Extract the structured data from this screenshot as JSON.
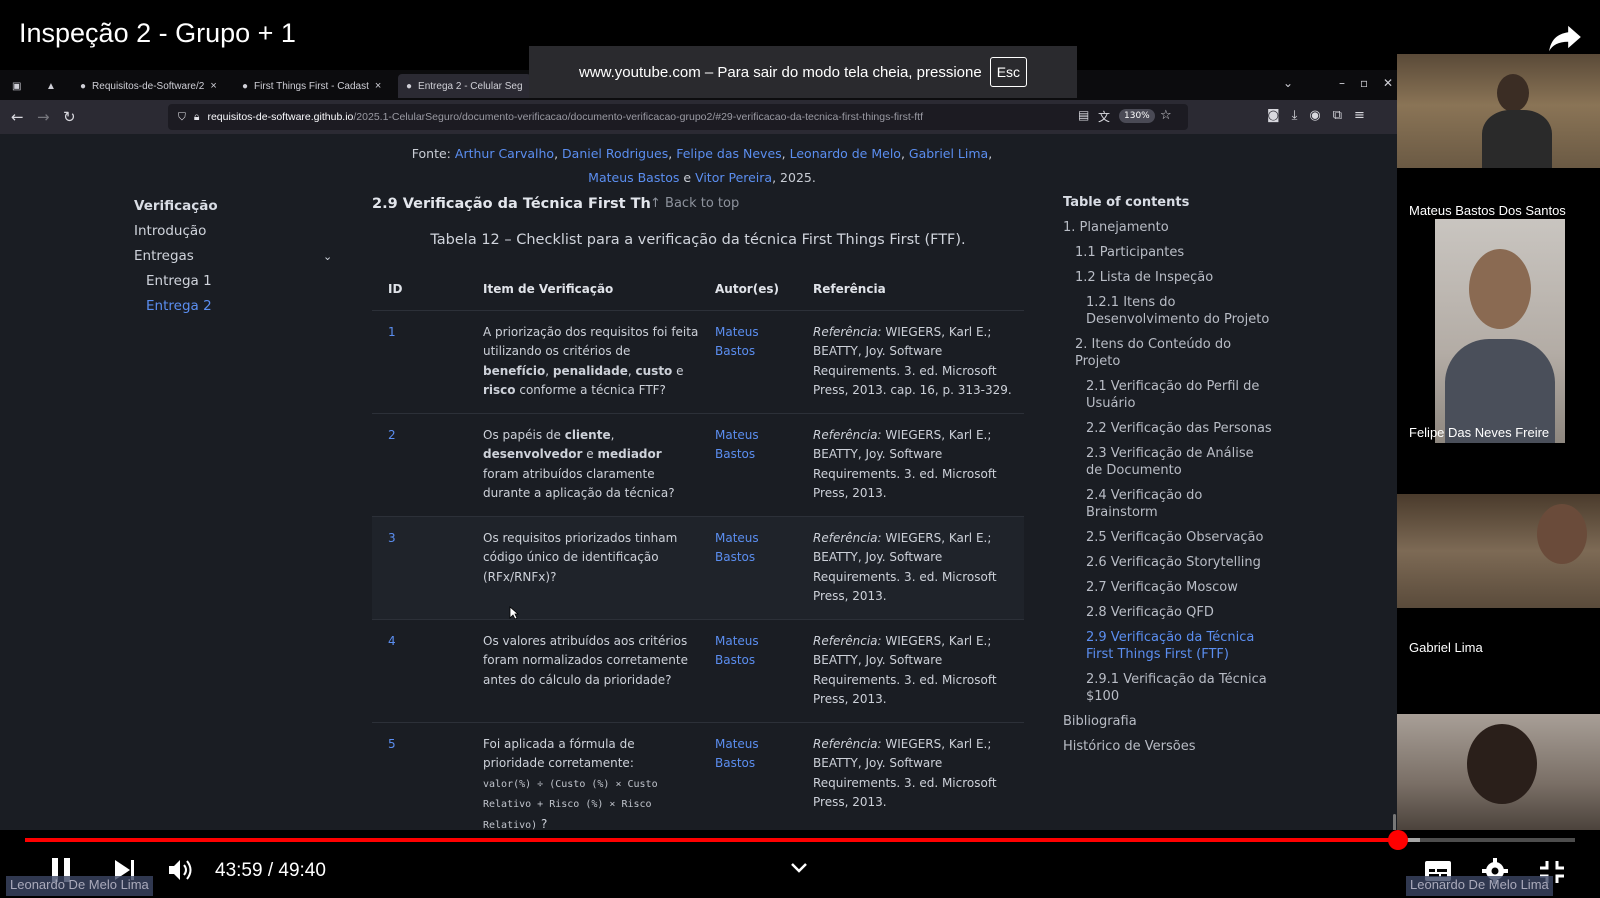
{
  "video": {
    "title": "Inspeção 2 - Grupo + 1",
    "time_current": "43:59",
    "time_separator": "/",
    "time_total": "49:40",
    "progress_fraction": 0.886,
    "buffered_fraction": 0.9
  },
  "fullscreen_notice": {
    "text": "www.youtube.com – Para sair do modo tela cheia, pressione",
    "key": "Esc"
  },
  "browser": {
    "tabs": [
      {
        "label": "Requisitos-de-Software/2",
        "close": "×"
      },
      {
        "label": "First Things First - Cadast",
        "close": "×"
      },
      {
        "label": "Entrega 2 - Celular Seg",
        "close": ""
      }
    ],
    "url_host": "requisitos-de-software.github.io",
    "url_path": "/2025.1-CelularSeguro/documento-verificacao/documento-verificacao-grupo2/#29-verificacao-da-tecnica-first-things-first-ftf",
    "zoom": "130%"
  },
  "page": {
    "fonte_label": "Fonte:",
    "fonte_authors": [
      "Arthur Carvalho",
      "Daniel Rodrigues",
      "Felipe das Neves",
      "Leonardo de Melo",
      "Gabriel Lima",
      "Mateus Bastos",
      "Vitor Pereira"
    ],
    "fonte_year": ", 2025.",
    "fonte_and": " e ",
    "left_nav": {
      "heading": "Verificação",
      "items": [
        "Introdução",
        "Entregas",
        "Entrega 1",
        "Entrega 2"
      ]
    },
    "section_title": "2.9 Verificação da Técnica First Th",
    "back_to_top": "Back to top",
    "caption": "Tabela 12 – Checklist para a verificação da técnica First Things First (FTF).",
    "table": {
      "headers": [
        "ID",
        "Item de Verificação",
        "Autor(es)",
        "Referência"
      ],
      "rows": [
        {
          "id": "1",
          "author": "Mateus Bastos",
          "ref": "WIEGERS, Karl E.; BEATTY, Joy. Software Requirements. 3. ed. Microsoft Press, 2013. cap. 16, p. 313-329."
        },
        {
          "id": "2",
          "author": "Mateus Bastos",
          "ref": "WIEGERS, Karl E.; BEATTY, Joy. Software Requirements. 3. ed. Microsoft Press, 2013."
        },
        {
          "id": "3",
          "author": "Mateus Bastos",
          "ref": "WIEGERS, Karl E.; BEATTY, Joy. Software Requirements. 3. ed. Microsoft Press, 2013."
        },
        {
          "id": "4",
          "author": "Mateus Bastos",
          "ref": "WIEGERS, Karl E.; BEATTY, Joy. Software Requirements. 3. ed. Microsoft Press, 2013."
        },
        {
          "id": "5",
          "author": "Mateus Bastos",
          "ref": "WIEGERS, Karl E.; BEATTY, Joy. Software Requirements. 3. ed. Microsoft Press, 2013."
        }
      ],
      "ref_prefix": "Referência:",
      "row1_item": {
        "a": "A priorização dos requisitos foi feita utilizando os critérios de ",
        "b1": "benefício",
        "c1": ", ",
        "b2": "penalidade",
        "c2": ", ",
        "b3": "custo",
        "c3": " e ",
        "b4": "risco",
        "d": " conforme a técnica FTF?"
      },
      "row2_item": {
        "a": "Os papéis de ",
        "b1": "cliente",
        "c1": ", ",
        "b2": "desenvolvedor",
        "c2": " e ",
        "b3": "mediador",
        "d": " foram atribuídos claramente durante a aplicação da técnica?"
      },
      "row3_item": "Os requisitos priorizados tinham código único de identificação (RFx/RNFx)?",
      "row4_item": "Os valores atribuídos aos critérios foram normalizados corretamente antes do cálculo da prioridade?",
      "row5_item": {
        "a": "Foi aplicada a fórmula de prioridade corretamente:",
        "code": "valor(%) ÷ (Custo (%) × Custo Relativo + Risco (%) × Risco Relativo)",
        "d": " ?"
      }
    },
    "toc": {
      "heading": "Table of contents",
      "entries": [
        {
          "label": "1. Planejamento",
          "level": 1
        },
        {
          "label": "1.1 Participantes",
          "level": 2
        },
        {
          "label": "1.2 Lista de Inspeção",
          "level": 2
        },
        {
          "label": "1.2.1 Itens do Desenvolvimento do Projeto",
          "level": 3
        },
        {
          "label": "2. Itens do Conteúdo do Projeto",
          "level": 2
        },
        {
          "label": "2.1 Verificação do Perfil de Usuário",
          "level": 3
        },
        {
          "label": "2.2 Verificação das Personas",
          "level": 3
        },
        {
          "label": "2.3 Verificação de Análise de Documento",
          "level": 3
        },
        {
          "label": "2.4 Verificação do Brainstorm",
          "level": 3
        },
        {
          "label": "2.5 Verificação Observação",
          "level": 3
        },
        {
          "label": "2.6 Verificação Storytelling",
          "level": 3
        },
        {
          "label": "2.7 Verificação Moscow",
          "level": 3
        },
        {
          "label": "2.8 Verificação QFD",
          "level": 3
        },
        {
          "label": "2.9 Verificação da Técnica First Things First (FTF)",
          "level": 3,
          "active": true
        },
        {
          "label": "2.9.1 Verificação da Técnica $100",
          "level": 3
        },
        {
          "label": "Bibliografia",
          "level": 1
        },
        {
          "label": "Histórico de Versões",
          "level": 1
        }
      ]
    }
  },
  "participants": [
    {
      "name": "Mateus Bastos Dos Santos"
    },
    {
      "name": "Felipe Das Neves Freire"
    },
    {
      "name": "Gabriel Lima"
    }
  ],
  "corner_labels": [
    "Leonardo De Melo Lima",
    "Leonardo De Melo Lima"
  ],
  "colors": {
    "accent": "#5b8ef0",
    "progress": "#ff0000",
    "page_bg": "#1a1d23"
  }
}
